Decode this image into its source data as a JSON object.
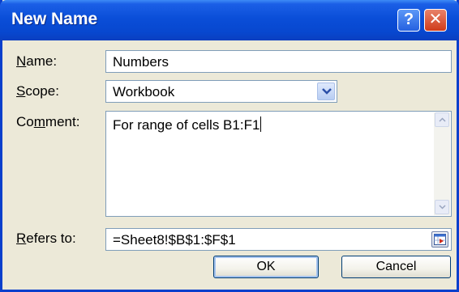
{
  "dialog": {
    "title": "New Name",
    "help_glyph": "?",
    "close_glyph": "✕"
  },
  "name": {
    "label_key": "N",
    "label_rest": "ame:",
    "value": "Numbers"
  },
  "scope": {
    "label_key": "S",
    "label_rest": "cope:",
    "value": "Workbook"
  },
  "comment": {
    "label_pre": "Co",
    "label_key": "m",
    "label_rest": "ment:",
    "value": "For range of cells B1:F1"
  },
  "refers_to": {
    "label_key": "R",
    "label_rest": "efers to:",
    "value": "=Sheet8!$B$1:$F$1"
  },
  "buttons": {
    "ok": "OK",
    "cancel": "Cancel"
  }
}
